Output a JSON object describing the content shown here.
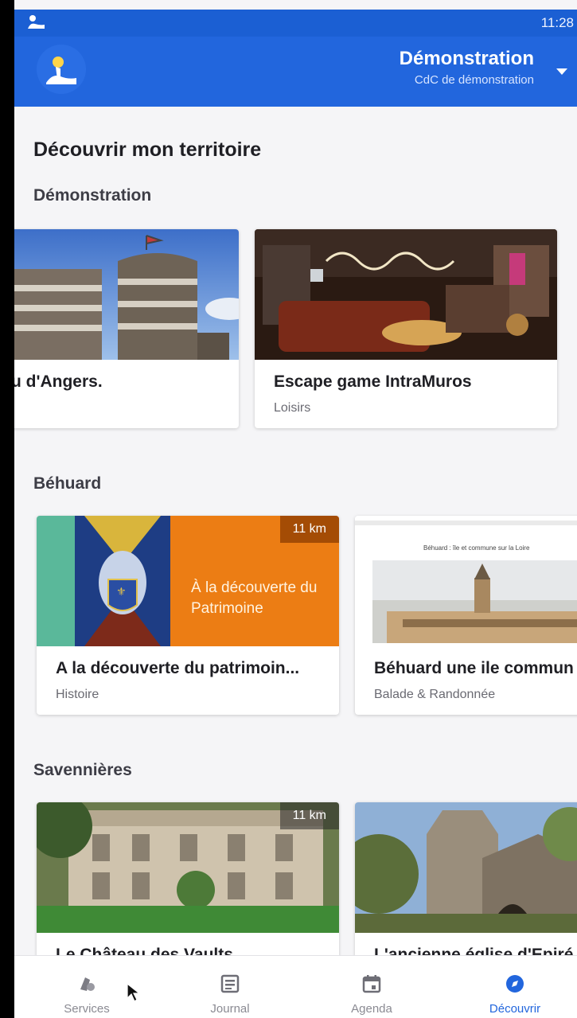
{
  "status_bar": {
    "time": "11:28"
  },
  "header": {
    "title": "Démonstration",
    "subtitle": "CdC de démonstration"
  },
  "page_title": "Découvrir mon territoire",
  "sections": [
    {
      "title": "Démonstration",
      "cards": [
        {
          "title": "u d'Angers.",
          "subtitle": ""
        },
        {
          "title": "Escape game IntraMuros",
          "subtitle": "Loisirs"
        }
      ]
    },
    {
      "title": "Béhuard",
      "cards": [
        {
          "title": "A la découverte du patrimoin...",
          "subtitle": "Histoire",
          "distance": "11 km",
          "image_text": "À la découverte du Patrimoine"
        },
        {
          "title": "Béhuard une ile commun",
          "subtitle": "Balade & Randonnée",
          "image_text": "Béhuard : île et commune sur la Loire"
        }
      ]
    },
    {
      "title": "Savennières",
      "cards": [
        {
          "title": "Le Château des Vaults",
          "subtitle": "",
          "distance": "11 km"
        },
        {
          "title": "L'ancienne église d'Epiré",
          "subtitle": ""
        }
      ]
    }
  ],
  "bottom_nav": [
    {
      "label": "Services",
      "icon": "services-icon",
      "active": false
    },
    {
      "label": "Journal",
      "icon": "journal-icon",
      "active": false
    },
    {
      "label": "Agenda",
      "icon": "calendar-icon",
      "active": false
    },
    {
      "label": "Découvrir",
      "icon": "compass-icon",
      "active": true
    }
  ],
  "colors": {
    "primary": "#2266dd",
    "status_bar": "#1b5fd3",
    "background": "#f5f5f7",
    "orange": "#ec7d14",
    "teal": "#5ab89a"
  }
}
